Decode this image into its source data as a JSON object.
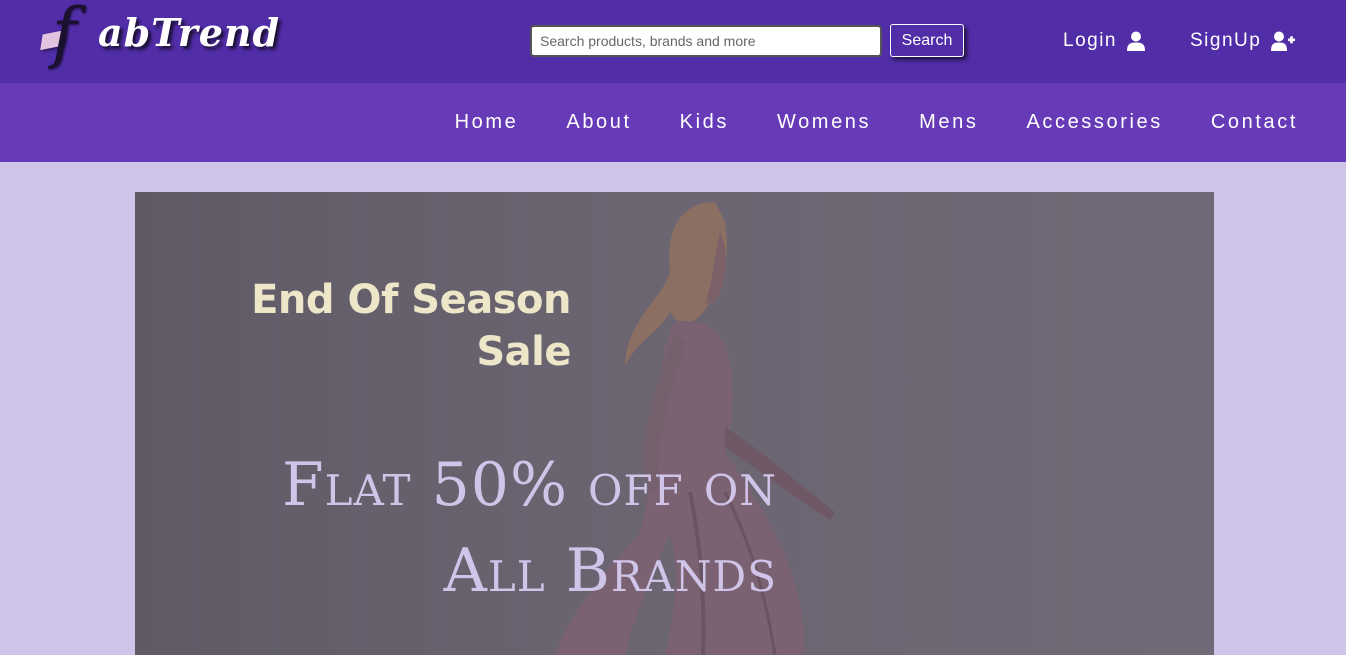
{
  "brand": {
    "logo_initial": "f",
    "logo_text": "abTrend"
  },
  "search": {
    "placeholder": "Search products, brands and more",
    "value": "",
    "button_label": "Search"
  },
  "auth": {
    "login_label": "Login",
    "login_icon": "user-icon",
    "signup_label": "SignUp",
    "signup_icon": "user-plus-icon"
  },
  "nav": {
    "items": [
      {
        "label": "Home"
      },
      {
        "label": "About"
      },
      {
        "label": "Kids"
      },
      {
        "label": "Womens"
      },
      {
        "label": "Mens"
      },
      {
        "label": "Accessories"
      },
      {
        "label": "Contact"
      }
    ]
  },
  "hero": {
    "sale_line1": "End Of Season",
    "sale_line2": "Sale",
    "offer_line1": "Flat 50% off on",
    "offer_line2": "All Brands"
  },
  "colors": {
    "topbar": "#512da8",
    "navbar": "#673ab7",
    "page_background": "#d1c4e9",
    "sale_text": "#ede6c8",
    "offer_text": "#d1c4e9"
  }
}
